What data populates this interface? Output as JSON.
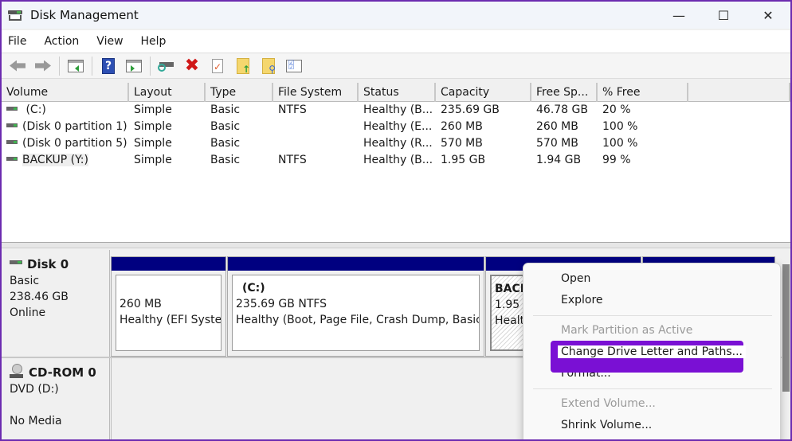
{
  "window": {
    "title": "Disk Management",
    "controls": {
      "minimize": "—",
      "maximize": "☐",
      "close": "✕"
    }
  },
  "menu": [
    "File",
    "Action",
    "View",
    "Help"
  ],
  "toolbar": {
    "icons": [
      "back-icon",
      "forward-icon",
      "show-hide-console-tree-icon",
      "help-icon",
      "show-hide-action-pane-icon",
      "connect-drive-icon",
      "delete-icon",
      "properties-icon",
      "export-icon",
      "find-icon",
      "settings-list-icon"
    ]
  },
  "volume_table": {
    "columns": [
      "Volume",
      "Layout",
      "Type",
      "File System",
      "Status",
      "Capacity",
      "Free Sp...",
      "% Free",
      ""
    ],
    "rows": [
      {
        "volume": " (C:)",
        "layout": "Simple",
        "type": "Basic",
        "fs": "NTFS",
        "status": "Healthy (B...",
        "capacity": "235.69 GB",
        "free": "46.78 GB",
        "pct": "20 %"
      },
      {
        "volume": "(Disk 0 partition 1)",
        "layout": "Simple",
        "type": "Basic",
        "fs": "",
        "status": "Healthy (E...",
        "capacity": "260 MB",
        "free": "260 MB",
        "pct": "100 %"
      },
      {
        "volume": "(Disk 0 partition 5)",
        "layout": "Simple",
        "type": "Basic",
        "fs": "",
        "status": "Healthy (R...",
        "capacity": "570 MB",
        "free": "570 MB",
        "pct": "100 %"
      },
      {
        "volume": "BACKUP (Y:)",
        "layout": "Simple",
        "type": "Basic",
        "fs": "NTFS",
        "status": "Healthy (B...",
        "capacity": "1.95 GB",
        "free": "1.94 GB",
        "pct": "99 %"
      }
    ]
  },
  "disks": [
    {
      "name": "Disk 0",
      "type": "Basic",
      "size": "238.46 GB",
      "state": "Online",
      "partitions": [
        {
          "title": "",
          "line1": "260 MB",
          "line2": "Healthy (EFI System"
        },
        {
          "title": "(C:)",
          "line1": "235.69 GB NTFS",
          "line2": "Healthy (Boot, Page File, Crash Dump, Basic D"
        },
        {
          "title": "BACKUP (Y:)",
          "line1": "1.95 GB NTFS",
          "line2": "Healthy (Basic Data Partition)"
        },
        {
          "title": "",
          "line1": "",
          "line2": ""
        }
      ]
    },
    {
      "name": "CD-ROM 0",
      "type": "DVD (D:)",
      "size": "",
      "state": "No Media"
    }
  ],
  "context_menu": {
    "items": [
      {
        "label": "Open",
        "disabled": false
      },
      {
        "label": "Explore",
        "disabled": false
      },
      {
        "separator": true
      },
      {
        "label": "Mark Partition as Active",
        "disabled": true
      },
      {
        "label": "Change Drive Letter and Paths...",
        "disabled": false,
        "highlighted": true
      },
      {
        "label": "Format...",
        "disabled": false
      },
      {
        "separator": true
      },
      {
        "label": "Extend Volume...",
        "disabled": true
      },
      {
        "label": "Shrink Volume...",
        "disabled": false
      }
    ]
  },
  "colors": {
    "partition_bar": "#000080",
    "highlight_outline": "#7a10d4",
    "window_border": "#6c2bb0"
  }
}
